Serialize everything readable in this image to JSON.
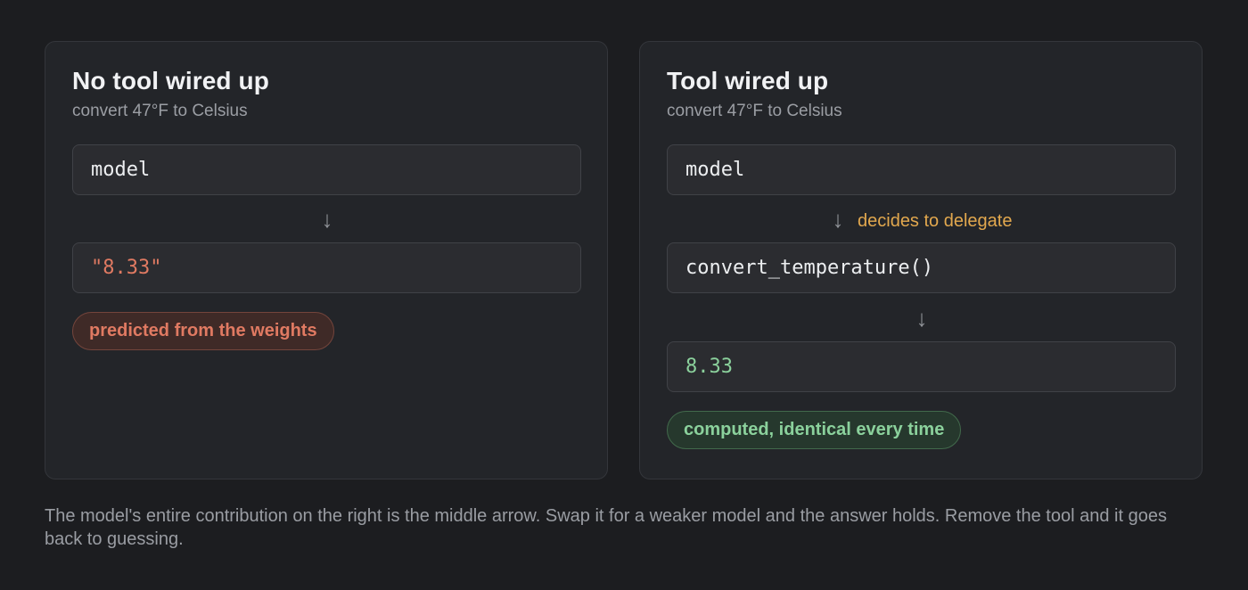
{
  "left_panel": {
    "title": "No tool wired up",
    "subtitle": "convert 47°F to Celsius",
    "model_label": "model",
    "arrow": "↓",
    "output": "\"8.33\"",
    "badge": "predicted from the weights"
  },
  "right_panel": {
    "title": "Tool wired up",
    "subtitle": "convert 47°F to Celsius",
    "model_label": "model",
    "arrow_1": "↓",
    "arrow_note": "decides to delegate",
    "tool_call": "convert_temperature()",
    "arrow_2": "↓",
    "output": "8.33",
    "badge": "computed, identical every time"
  },
  "caption": "The model's entire contribution on the right is the middle arrow. Swap it for a weaker model and the answer holds. Remove the tool and it goes back to guessing.",
  "colors": {
    "background": "#1c1d20",
    "panel": "#232529",
    "predicted_red": "#e07a62",
    "computed_green": "#8bd19c",
    "delegate_orange": "#e2a84e"
  }
}
